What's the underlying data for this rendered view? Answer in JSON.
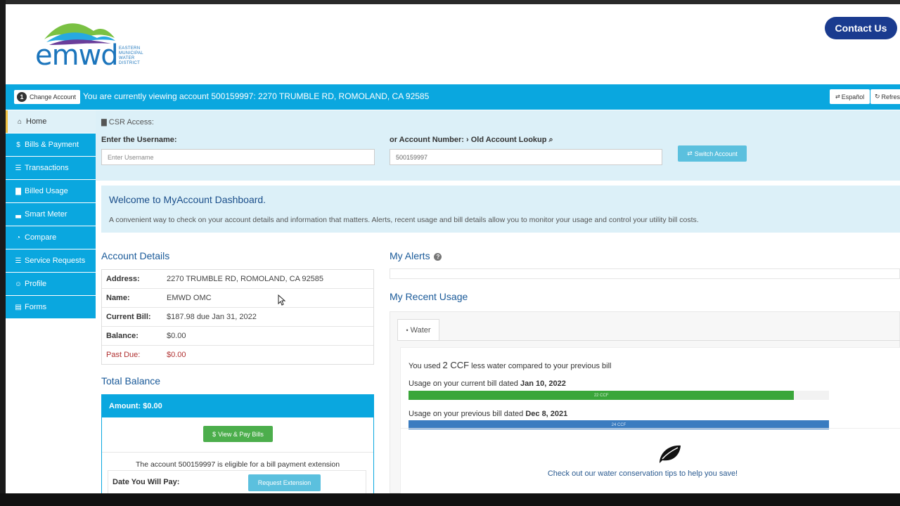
{
  "header": {
    "logo_text": "emwd",
    "logo_sub": "EASTERN MUNICIPAL WATER DISTRICT",
    "contact_label": "Contact Us"
  },
  "account_bar": {
    "step_number": "1",
    "change_account_label": "Change Account",
    "viewing_text": "You are currently viewing account 500159997: 2270 TRUMBLE RD, ROMOLAND, CA 92585",
    "language_label": "Español",
    "refresh_label": "Refresh"
  },
  "sidebar": {
    "items": [
      {
        "label": "Home",
        "icon": "home-icon"
      },
      {
        "label": "Bills & Payment",
        "icon": "dollar-icon"
      },
      {
        "label": "Transactions",
        "icon": "list-icon"
      },
      {
        "label": "Billed Usage",
        "icon": "bar-chart-icon"
      },
      {
        "label": "Smart Meter",
        "icon": "signal-icon"
      },
      {
        "label": "Compare",
        "icon": "dashboard-icon"
      },
      {
        "label": "Service Requests",
        "icon": "list-icon"
      },
      {
        "label": "Profile",
        "icon": "user-icon"
      },
      {
        "label": "Forms",
        "icon": "file-icon"
      }
    ]
  },
  "csr": {
    "title": "CSR Access:",
    "username_label": "Enter the Username:",
    "username_placeholder": "Enter Username",
    "account_label": "or Account Number:",
    "old_lookup_label": "Old Account Lookup",
    "account_value": "500159997",
    "switch_label": "Switch Account"
  },
  "welcome": {
    "title": "Welcome to MyAccount Dashboard.",
    "text": "A convenient way to check on your account details and information that matters. Alerts, recent usage and bill details allow you to monitor your usage and control your utility bill costs."
  },
  "account_details": {
    "title": "Account Details",
    "rows": [
      {
        "key": "Address:",
        "value": "2270 TRUMBLE RD, ROMOLAND, CA 92585"
      },
      {
        "key": "Name:",
        "value": "EMWD OMC"
      },
      {
        "key": "Current Bill:",
        "value": "$187.98 due Jan 31, 2022"
      },
      {
        "key": "Balance:",
        "value": "$0.00"
      },
      {
        "key": "Past Due:",
        "value": "$0.00"
      }
    ]
  },
  "total_balance": {
    "title": "Total Balance",
    "amount_text": "Amount: $0.00",
    "pay_label": "View & Pay Bills",
    "eligible_text": "The account 500159997 is eligible for a bill payment extension",
    "date_label": "Date You Will Pay:",
    "request_label": "Request Extension"
  },
  "alerts": {
    "title": "My Alerts"
  },
  "usage": {
    "title": "My Recent Usage",
    "tab_label": "Water",
    "used_prefix": "You used",
    "used_amount": "2 CCF",
    "used_suffix": "less water compared to your previous bill",
    "current_label": "Usage on your current bill dated",
    "current_date": "Jan 10, 2022",
    "current_bar_text": "22 CCF",
    "current_fraction": 0.917,
    "previous_label": "Usage on your previous bill dated",
    "previous_date": "Dec 8, 2021",
    "previous_bar_text": "24 CCF",
    "previous_fraction": 1.0,
    "tips_text": "Check out our water conservation tips to help you save!"
  },
  "colors": {
    "primary": "#0aa7df",
    "navy": "#1a3b8f",
    "heading": "#1a5a99",
    "green": "#3aa63a",
    "blue": "#3a7cc0",
    "past_due": "#b03030"
  }
}
